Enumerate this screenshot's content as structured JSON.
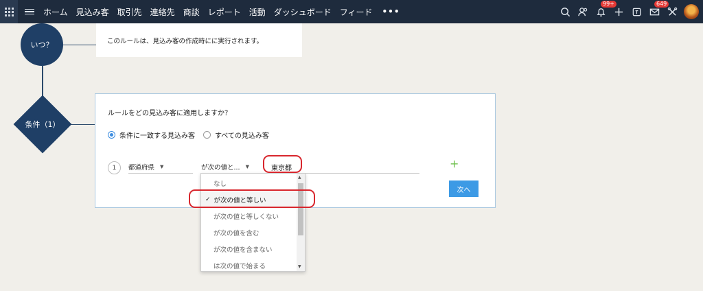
{
  "nav": {
    "items": [
      "ホーム",
      "見込み客",
      "取引先",
      "連絡先",
      "商談",
      "レポート",
      "活動",
      "ダッシュボード",
      "フィード"
    ],
    "more": "•••",
    "notifications_badge": "99+",
    "mail_badge": "649"
  },
  "flow": {
    "when_node": "いつ？",
    "condition_node": "条件（1）"
  },
  "info": {
    "text": "このルールは、見込み客の作成時にに実行されます。"
  },
  "rule": {
    "question": "ルールをどの見込み客に適用しますか？",
    "options": [
      {
        "label": "条件に一致する見込み客",
        "checked": true
      },
      {
        "label": "すべての見込み客",
        "checked": false
      }
    ],
    "condition": {
      "number": "1",
      "field": "都道府県",
      "operator": "が次の値と...",
      "value": "東京都"
    },
    "add_label": "+",
    "next_button": "次へ"
  },
  "dropdown": {
    "items": [
      {
        "label": "なし",
        "selected": false
      },
      {
        "label": "が次の値と等しい",
        "selected": true
      },
      {
        "label": "が次の値と等しくない",
        "selected": false
      },
      {
        "label": "が次の値を含む",
        "selected": false
      },
      {
        "label": "が次の値を含まない",
        "selected": false
      },
      {
        "label": "は次の値で始まる",
        "selected": false
      }
    ],
    "check_mark": "✓"
  },
  "colors": {
    "nav_bg": "#1e2b3d",
    "node": "#1f3f66",
    "accent": "#3d9ae5",
    "highlight": "#d8262d"
  }
}
